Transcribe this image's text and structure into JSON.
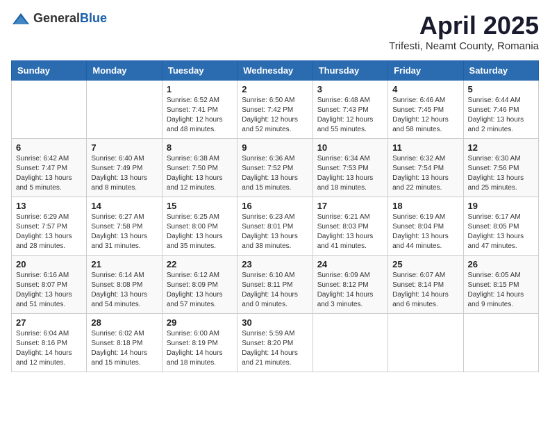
{
  "header": {
    "logo_general": "General",
    "logo_blue": "Blue",
    "title": "April 2025",
    "location": "Trifesti, Neamt County, Romania"
  },
  "calendar": {
    "days_of_week": [
      "Sunday",
      "Monday",
      "Tuesday",
      "Wednesday",
      "Thursday",
      "Friday",
      "Saturday"
    ],
    "weeks": [
      [
        {
          "day": "",
          "info": ""
        },
        {
          "day": "",
          "info": ""
        },
        {
          "day": "1",
          "info": "Sunrise: 6:52 AM\nSunset: 7:41 PM\nDaylight: 12 hours and 48 minutes."
        },
        {
          "day": "2",
          "info": "Sunrise: 6:50 AM\nSunset: 7:42 PM\nDaylight: 12 hours and 52 minutes."
        },
        {
          "day": "3",
          "info": "Sunrise: 6:48 AM\nSunset: 7:43 PM\nDaylight: 12 hours and 55 minutes."
        },
        {
          "day": "4",
          "info": "Sunrise: 6:46 AM\nSunset: 7:45 PM\nDaylight: 12 hours and 58 minutes."
        },
        {
          "day": "5",
          "info": "Sunrise: 6:44 AM\nSunset: 7:46 PM\nDaylight: 13 hours and 2 minutes."
        }
      ],
      [
        {
          "day": "6",
          "info": "Sunrise: 6:42 AM\nSunset: 7:47 PM\nDaylight: 13 hours and 5 minutes."
        },
        {
          "day": "7",
          "info": "Sunrise: 6:40 AM\nSunset: 7:49 PM\nDaylight: 13 hours and 8 minutes."
        },
        {
          "day": "8",
          "info": "Sunrise: 6:38 AM\nSunset: 7:50 PM\nDaylight: 13 hours and 12 minutes."
        },
        {
          "day": "9",
          "info": "Sunrise: 6:36 AM\nSunset: 7:52 PM\nDaylight: 13 hours and 15 minutes."
        },
        {
          "day": "10",
          "info": "Sunrise: 6:34 AM\nSunset: 7:53 PM\nDaylight: 13 hours and 18 minutes."
        },
        {
          "day": "11",
          "info": "Sunrise: 6:32 AM\nSunset: 7:54 PM\nDaylight: 13 hours and 22 minutes."
        },
        {
          "day": "12",
          "info": "Sunrise: 6:30 AM\nSunset: 7:56 PM\nDaylight: 13 hours and 25 minutes."
        }
      ],
      [
        {
          "day": "13",
          "info": "Sunrise: 6:29 AM\nSunset: 7:57 PM\nDaylight: 13 hours and 28 minutes."
        },
        {
          "day": "14",
          "info": "Sunrise: 6:27 AM\nSunset: 7:58 PM\nDaylight: 13 hours and 31 minutes."
        },
        {
          "day": "15",
          "info": "Sunrise: 6:25 AM\nSunset: 8:00 PM\nDaylight: 13 hours and 35 minutes."
        },
        {
          "day": "16",
          "info": "Sunrise: 6:23 AM\nSunset: 8:01 PM\nDaylight: 13 hours and 38 minutes."
        },
        {
          "day": "17",
          "info": "Sunrise: 6:21 AM\nSunset: 8:03 PM\nDaylight: 13 hours and 41 minutes."
        },
        {
          "day": "18",
          "info": "Sunrise: 6:19 AM\nSunset: 8:04 PM\nDaylight: 13 hours and 44 minutes."
        },
        {
          "day": "19",
          "info": "Sunrise: 6:17 AM\nSunset: 8:05 PM\nDaylight: 13 hours and 47 minutes."
        }
      ],
      [
        {
          "day": "20",
          "info": "Sunrise: 6:16 AM\nSunset: 8:07 PM\nDaylight: 13 hours and 51 minutes."
        },
        {
          "day": "21",
          "info": "Sunrise: 6:14 AM\nSunset: 8:08 PM\nDaylight: 13 hours and 54 minutes."
        },
        {
          "day": "22",
          "info": "Sunrise: 6:12 AM\nSunset: 8:09 PM\nDaylight: 13 hours and 57 minutes."
        },
        {
          "day": "23",
          "info": "Sunrise: 6:10 AM\nSunset: 8:11 PM\nDaylight: 14 hours and 0 minutes."
        },
        {
          "day": "24",
          "info": "Sunrise: 6:09 AM\nSunset: 8:12 PM\nDaylight: 14 hours and 3 minutes."
        },
        {
          "day": "25",
          "info": "Sunrise: 6:07 AM\nSunset: 8:14 PM\nDaylight: 14 hours and 6 minutes."
        },
        {
          "day": "26",
          "info": "Sunrise: 6:05 AM\nSunset: 8:15 PM\nDaylight: 14 hours and 9 minutes."
        }
      ],
      [
        {
          "day": "27",
          "info": "Sunrise: 6:04 AM\nSunset: 8:16 PM\nDaylight: 14 hours and 12 minutes."
        },
        {
          "day": "28",
          "info": "Sunrise: 6:02 AM\nSunset: 8:18 PM\nDaylight: 14 hours and 15 minutes."
        },
        {
          "day": "29",
          "info": "Sunrise: 6:00 AM\nSunset: 8:19 PM\nDaylight: 14 hours and 18 minutes."
        },
        {
          "day": "30",
          "info": "Sunrise: 5:59 AM\nSunset: 8:20 PM\nDaylight: 14 hours and 21 minutes."
        },
        {
          "day": "",
          "info": ""
        },
        {
          "day": "",
          "info": ""
        },
        {
          "day": "",
          "info": ""
        }
      ]
    ]
  }
}
